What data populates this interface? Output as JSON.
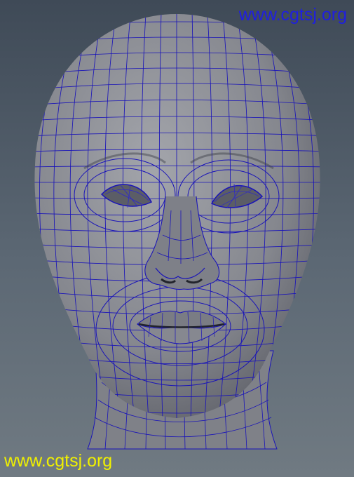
{
  "viewport": {
    "background_top": "#3f4a57",
    "background_bottom": "#707a82",
    "mesh_fill": "#8c8e95",
    "wire_color": "#1a14b8"
  },
  "watermarks": {
    "top": {
      "text": "www.cgtsj.org",
      "color": "#1f1fe0"
    },
    "bottom": {
      "text": "www.cgtsj.org",
      "color": "#f0f000"
    }
  },
  "icons": {
    "head_mesh": "wireframe-head-mesh"
  }
}
